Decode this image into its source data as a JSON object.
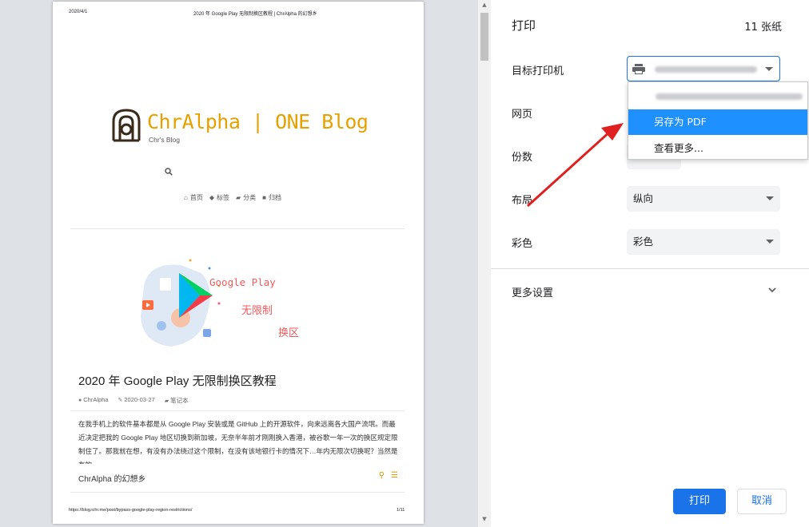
{
  "preview": {
    "header_date": "2020/4/1",
    "header_title": "2020 年 Google Play 无限制换区教程 | ChrAlpha 的幻想乡",
    "logo_text": "ChrAlpha | ONE Blog",
    "logo_sub": "Chr's Blog",
    "nav": [
      {
        "icon": "home-icon",
        "label": "首页"
      },
      {
        "icon": "tags-icon",
        "label": "标签"
      },
      {
        "icon": "folder-icon",
        "label": "分类"
      },
      {
        "icon": "archive-icon",
        "label": "归档"
      }
    ],
    "banner": {
      "line1": "Google Play",
      "line2": "无限制",
      "line3": "换区"
    },
    "post_title": "2020 年 Google Play 无限制换区教程",
    "meta": {
      "author": "ChrAlpha",
      "date": "2020-03-27",
      "category": "笔记本"
    },
    "body_text": "在我手机上的软件基本都是从 Google Play 安装或是 GitHub 上的开源软件，向来远离各大国产流氓。而最近决定把我的 Google Play 地区切换到新加坡，无奈半年前才刚刚换入香港，被谷歌一年一次的换区规定限制住了。那我就在想，有没有办法绕过这个限制，在没有该地银行卡的情况下…年内无限次切换呢？当然是有的。",
    "footer_title": "ChrAlpha 的幻想乡",
    "footer_url": "https://blog.ichr.me/post/bypass-google-play-region-restrictions/",
    "footer_page": "1/11"
  },
  "settings": {
    "title": "打印",
    "sheets": "11 张纸",
    "destination_label": "目标打印机",
    "pages_label": "网页",
    "copies_label": "份数",
    "layout_label": "布局",
    "layout_value": "纵向",
    "color_label": "彩色",
    "color_value": "彩色",
    "more_settings": "更多设置",
    "print_button": "打印",
    "cancel_button": "取消"
  },
  "dropdown": {
    "options": [
      "另存为 PDF",
      "查看更多..."
    ],
    "selected": "另存为 PDF"
  },
  "colors": {
    "accent": "#1a73e8",
    "highlight": "#1e90ff",
    "logo": "#e6a100",
    "arrow": "#e02020"
  }
}
